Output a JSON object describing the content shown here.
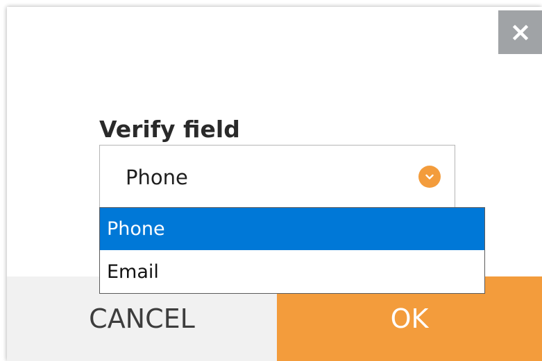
{
  "dialog": {
    "close_icon": "close-icon",
    "field_label": "Verify field",
    "select": {
      "value": "Phone",
      "icon": "chevron-down-icon",
      "options": [
        "Phone",
        "Email"
      ],
      "highlighted_index": 0
    },
    "buttons": {
      "cancel_label": "CANCEL",
      "ok_label": "OK"
    }
  },
  "colors": {
    "accent": "#f39c3c",
    "selection": "#0078d7",
    "close_bg": "#a0a3a6",
    "cancel_bg": "#f1f1f1"
  }
}
